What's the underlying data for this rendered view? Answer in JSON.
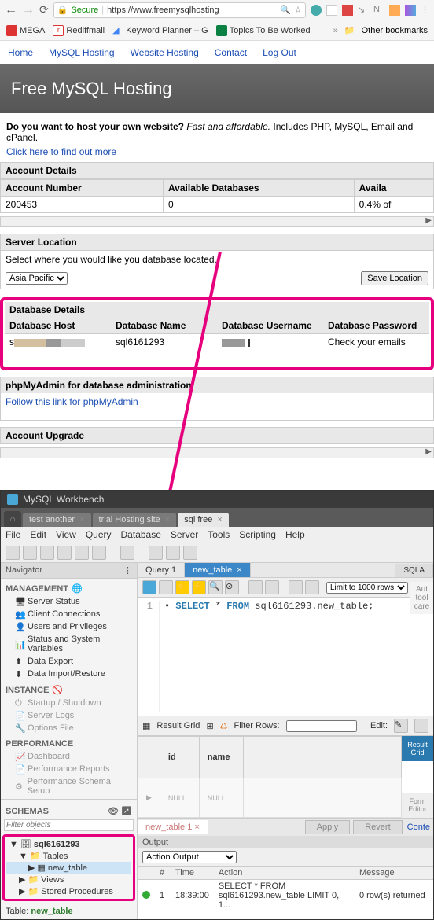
{
  "browser": {
    "secure_label": "Secure",
    "url": "https://www.freemysqlhosting",
    "bookmarks": {
      "mega": "MEGA",
      "rediff": "Rediffmail",
      "kw": "Keyword Planner – G",
      "topics": "Topics To Be Worked",
      "other": "Other bookmarks"
    }
  },
  "nav": {
    "home": "Home",
    "mysql": "MySQL Hosting",
    "web": "Website Hosting",
    "contact": "Contact",
    "logout": "Log Out"
  },
  "hero_title": "Free MySQL Hosting",
  "promo": {
    "q": "Do you want to host your own website?",
    "em": "Fast and affordable.",
    "rest": " Includes PHP, MySQL, Email and cPanel.",
    "link": "Click here to find out more"
  },
  "account": {
    "hdr": "Account Details",
    "num_h": "Account Number",
    "num": "200453",
    "avail_h": "Available Databases",
    "avail": "0",
    "avail2_h": "Availa",
    "avail2": "0.4% of"
  },
  "server": {
    "hdr": "Server Location",
    "sub": "Select where you would like you database located.",
    "sel": "Asia Pacific",
    "save": "Save Location"
  },
  "db": {
    "hdr": "Database Details",
    "host_h": "Database Host",
    "name_h": "Database Name",
    "name": "sql6161293",
    "user_h": "Database Username",
    "pass_h": "Database Password",
    "pass": "Check your emails"
  },
  "phpma": {
    "hdr": "phpMyAdmin for database administration",
    "link": "Follow this link for phpMyAdmin"
  },
  "upgrade_hdr": "Account Upgrade",
  "wb": {
    "title": "MySQL Workbench",
    "tabs": {
      "t1": "test another",
      "t2": "trial Hosting site",
      "t3": "sql free"
    },
    "menu": {
      "file": "File",
      "edit": "Edit",
      "view": "View",
      "query": "Query",
      "database": "Database",
      "server": "Server",
      "tools": "Tools",
      "scripting": "Scripting",
      "help": "Help"
    },
    "nav": {
      "title": "Navigator",
      "mgmt": "MANAGEMENT",
      "items_m": [
        "Server Status",
        "Client Connections",
        "Users and Privileges",
        "Status and System Variables",
        "Data Export",
        "Data Import/Restore"
      ],
      "inst": "INSTANCE",
      "items_i": [
        "Startup / Shutdown",
        "Server Logs",
        "Options File"
      ],
      "perf": "PERFORMANCE",
      "items_p": [
        "Dashboard",
        "Performance Reports",
        "Performance Schema Setup"
      ],
      "schemas": "SCHEMAS",
      "filter_ph": "Filter objects",
      "tree": {
        "db": "sql6161293",
        "tables": "Tables",
        "nt": "new_table",
        "views": "Views",
        "sp": "Stored Procedures"
      },
      "footer_l": "Table:",
      "footer_v": "new_table"
    },
    "query": {
      "tab1": "Query 1",
      "tab2": "new_table",
      "limit": "Limit to 1000 rows",
      "sql_kw1": "SELECT",
      "sql_r1": " * ",
      "sql_kw2": "FROM",
      "sql_r2": " sql6161293.new_table;",
      "sqla": "SQLA"
    },
    "side_ad": "Aut\ntool\ncare",
    "result": {
      "rg": "Result Grid",
      "fr": "Filter Rows:",
      "edit": "Edit:",
      "cols": {
        "id": "id",
        "name": "name"
      },
      "null": "NULL",
      "rgrid": "Result\nGrid",
      "fedit": "Form\nEditor",
      "rtab": "new_table 1",
      "apply": "Apply",
      "revert": "Revert",
      "cont": "Conte"
    },
    "output": {
      "hdr": "Output",
      "sel": "Action Output",
      "cols": {
        "n": "#",
        "time": "Time",
        "action": "Action",
        "msg": "Message"
      },
      "row": {
        "n": "1",
        "time": "18:39:00",
        "action": "SELECT * FROM sql6161293.new_table LIMIT 0, 1...",
        "msg": "0 row(s) returned"
      }
    }
  }
}
